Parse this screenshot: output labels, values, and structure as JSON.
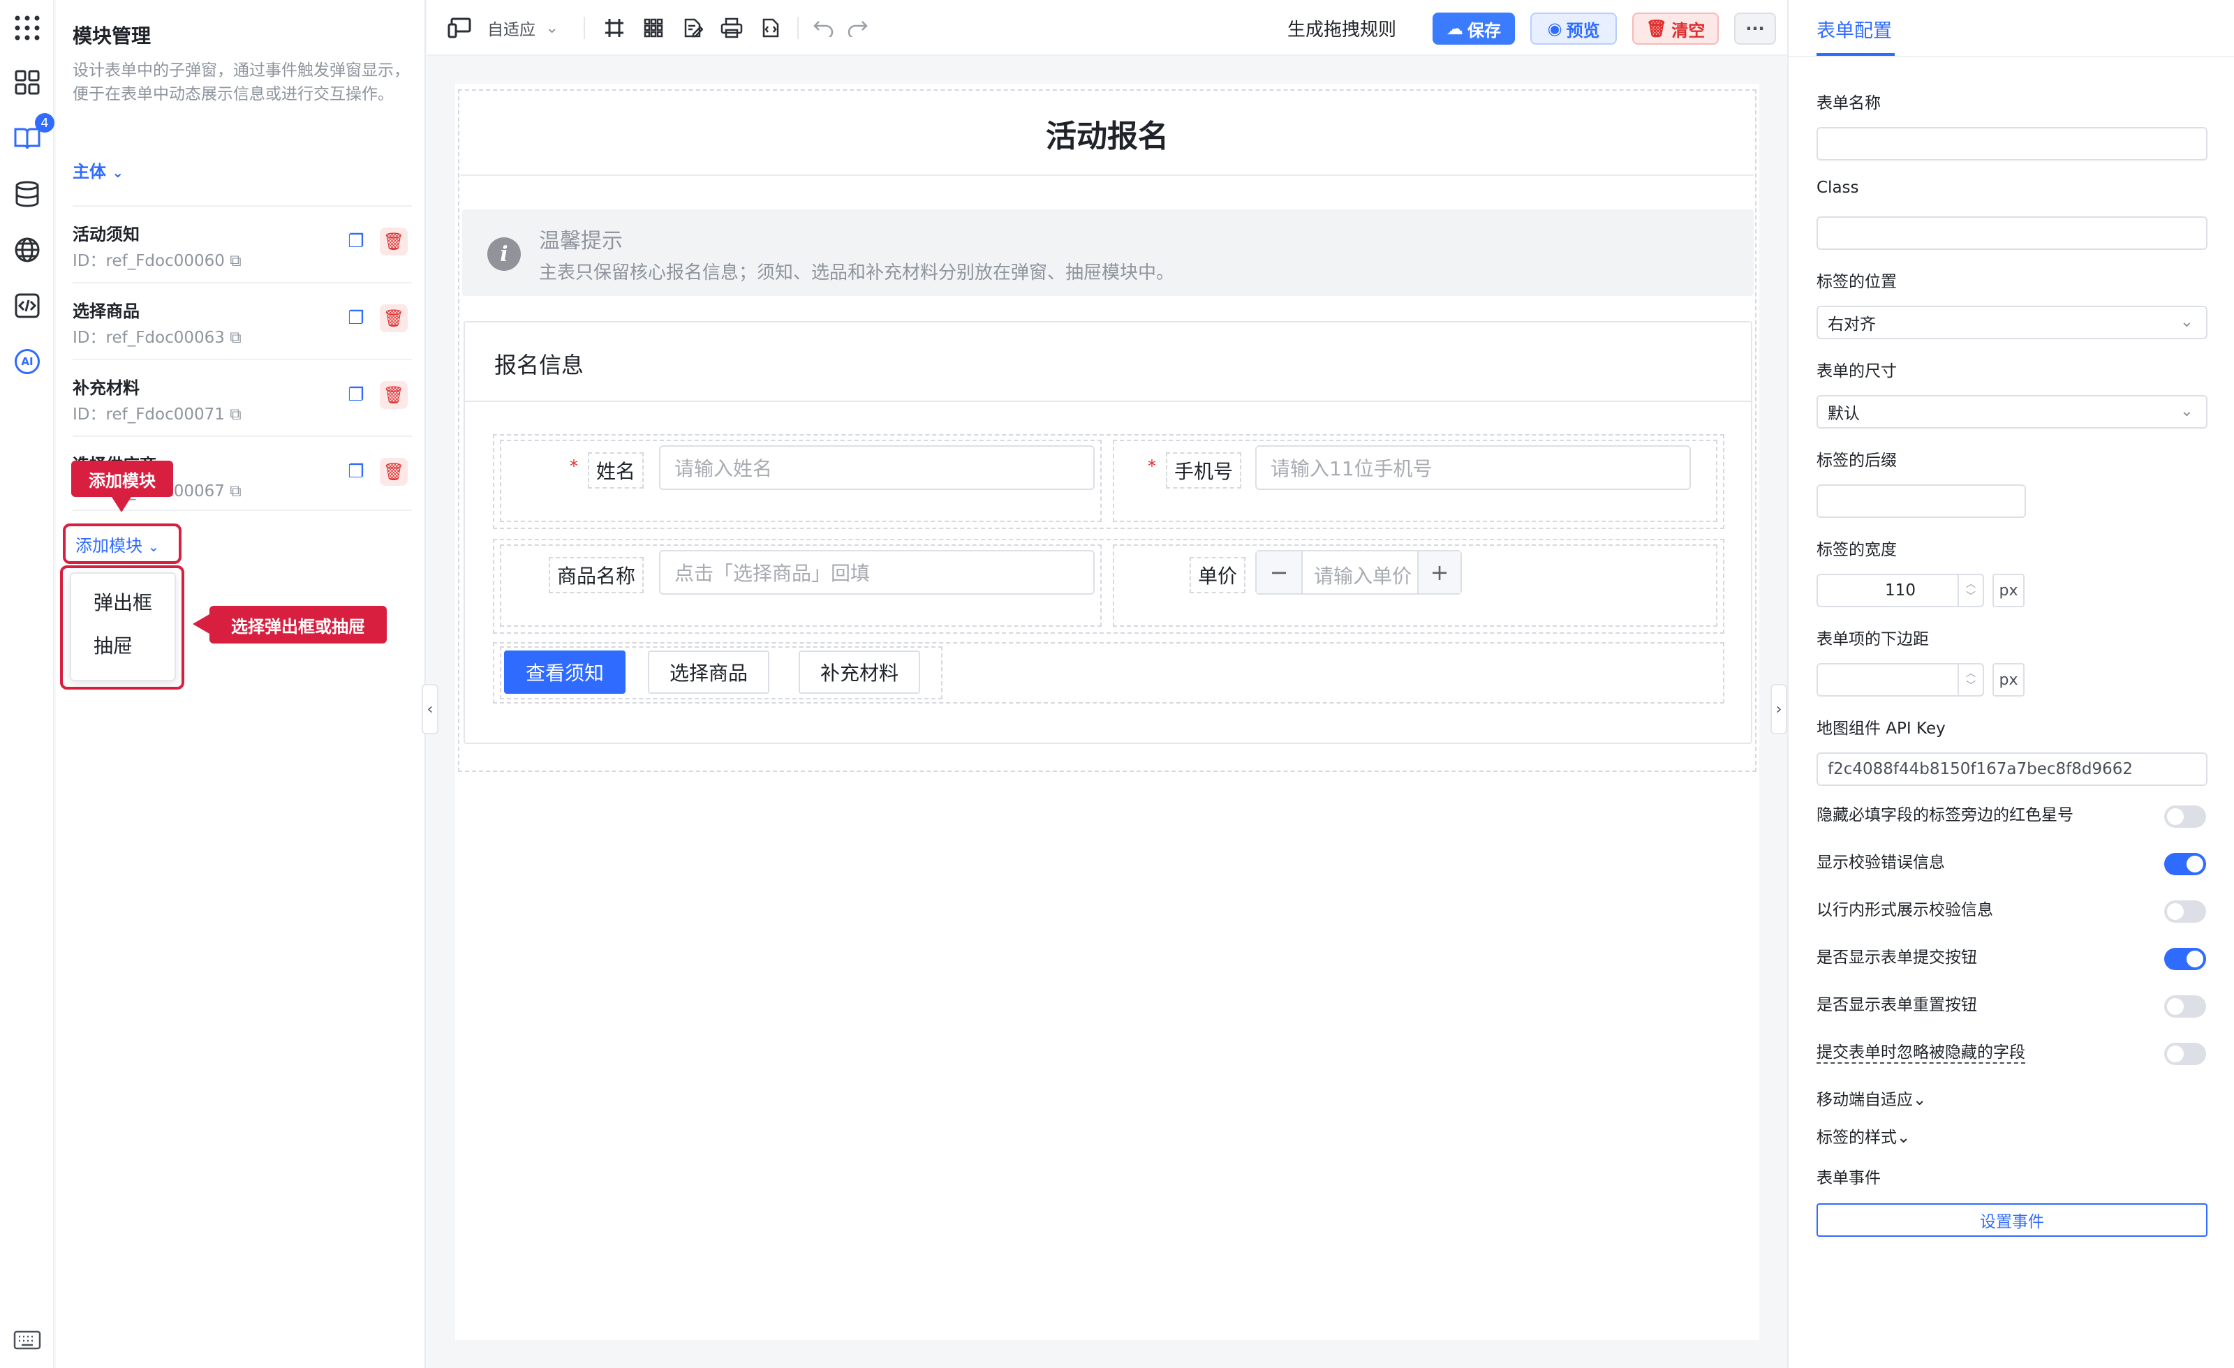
{
  "iconbar": {
    "badge": "4",
    "ai_label": "AI",
    "icons": [
      "apps-icon",
      "grid-icon",
      "book-icon",
      "database-icon",
      "globe-icon",
      "code-icon",
      "ai-icon",
      "keyboard-icon"
    ]
  },
  "module_panel": {
    "title": "模块管理",
    "description": "设计表单中的子弹窗，通过事件触发弹窗显示，便于在表单中动态展示信息或进行交互操作。",
    "subject": "主体",
    "modules": [
      {
        "name": "活动须知",
        "id": "ID：ref_Fdoc00060"
      },
      {
        "name": "选择商品",
        "id": "ID：ref_Fdoc00063"
      },
      {
        "name": "补充材料",
        "id": "ID：ref_Fdoc00071"
      },
      {
        "name": "选择供应商",
        "id": "ID：ref_Fdoc00067"
      }
    ],
    "add_module": "添加模块",
    "dropdown_items": [
      "弹出框",
      "抽屉"
    ]
  },
  "callouts": {
    "add_module": "添加模块",
    "choose": "选择弹出框或抽屉"
  },
  "toolbar": {
    "device": "自适应",
    "generate_rule": "生成拖拽规则",
    "save": "保存",
    "preview": "预览",
    "clear": "清空",
    "more": "···"
  },
  "form": {
    "title": "活动报名",
    "tip_title": "温馨提示",
    "tip_text": "主表只保留核心报名信息；须知、选品和补充材料分别放在弹窗、抽屉模块中。",
    "section_title": "报名信息",
    "fields": {
      "name_label": "姓名",
      "name_placeholder": "请输入姓名",
      "phone_label": "手机号",
      "phone_placeholder": "请输入11位手机号",
      "product_label": "商品名称",
      "product_placeholder": "点击「选择商品」回填",
      "price_label": "单价",
      "price_placeholder": "请输入单价",
      "required_mark": "*"
    },
    "buttons": [
      "查看须知",
      "选择商品",
      "补充材料"
    ]
  },
  "right_panel": {
    "tab": "表单配置",
    "form_name": {
      "label": "表单名称",
      "value": ""
    },
    "class": {
      "label": "Class",
      "value": ""
    },
    "label_position": {
      "label": "标签的位置",
      "value": "右对齐"
    },
    "form_size": {
      "label": "表单的尺寸",
      "value": "默认"
    },
    "label_suffix": {
      "label": "标签的后缀",
      "value": ""
    },
    "label_width": {
      "label": "标签的宽度",
      "value": "110",
      "unit": "px"
    },
    "item_margin": {
      "label": "表单项的下边距",
      "value": "",
      "unit": "px"
    },
    "map_key": {
      "label": "地图组件 API Key",
      "value": "f2c4088f44b8150f167a7bec8f8d9662"
    },
    "switches": [
      {
        "label": "隐藏必填字段的标签旁边的红色星号",
        "on": false
      },
      {
        "label": "显示校验错误信息",
        "on": true
      },
      {
        "label": "以行内形式展示校验信息",
        "on": false
      },
      {
        "label": "是否显示表单提交按钮",
        "on": true
      },
      {
        "label": "是否显示表单重置按钮",
        "on": false
      },
      {
        "label": "提交表单时忽略被隐藏的字段",
        "on": false
      }
    ],
    "mobile_adapt": "移动端自适应",
    "label_style": "标签的样式",
    "form_events": "表单事件",
    "set_event": "设置事件",
    "accent": "#2f6bff"
  }
}
